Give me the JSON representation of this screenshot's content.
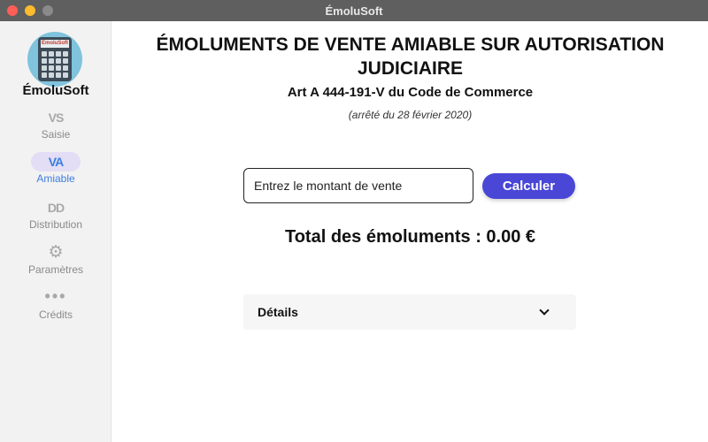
{
  "window": {
    "title": "ÉmoluSoft"
  },
  "sidebar": {
    "logo_text": "ÉmoluSoft",
    "app_name": "ÉmoluSoft",
    "items": [
      {
        "icon_text": "VS",
        "label": "Saisie",
        "active": false
      },
      {
        "icon_text": "VA",
        "label": "Amiable",
        "active": true
      },
      {
        "icon_text": "DD",
        "label": "Distribution",
        "active": false
      },
      {
        "icon_text": "⚙",
        "icon": "gear-icon",
        "label": "Paramètres",
        "active": false
      },
      {
        "icon_text": "•••",
        "icon": "more-icon",
        "label": "Crédits",
        "active": false
      }
    ]
  },
  "main": {
    "title": "ÉMOLUMENTS DE VENTE AMIABLE SUR AUTORISATION JUDICIAIRE",
    "subtitle": "Art A 444-191-V du Code de Commerce",
    "date": "(arrêté du 28 février 2020)",
    "amount_placeholder": "Entrez le montant de vente",
    "calculate_label": "Calculer",
    "total": "Total des émoluments : 0.00 €",
    "details_label": "Détails"
  },
  "colors": {
    "accent": "#4a46d6",
    "active_nav": "#3b7de0",
    "active_nav_bg": "#e3ddf6"
  }
}
